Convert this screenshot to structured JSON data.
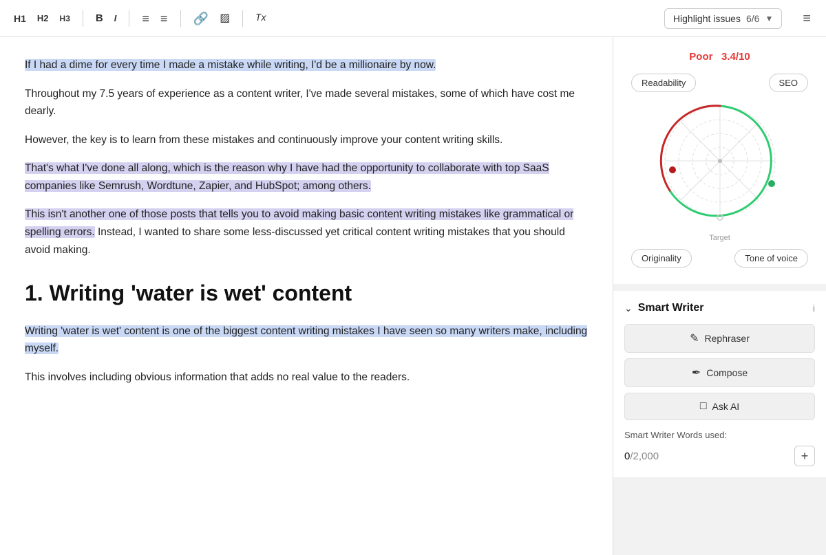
{
  "toolbar": {
    "h1_label": "H1",
    "h2_label": "H2",
    "h3_label": "H3",
    "bold_label": "B",
    "italic_label": "I",
    "ol_icon": "≡",
    "ul_icon": "≡",
    "link_icon": "🔗",
    "image_icon": "▣",
    "eraser_label": "Tx",
    "highlight_label": "Highlight issues",
    "highlight_count": "6/6",
    "hamburger": "≡"
  },
  "score": {
    "prefix": "Poor",
    "value": "3.4",
    "suffix": "/10"
  },
  "radar_labels": {
    "readability": "Readability",
    "seo": "SEO",
    "originality": "Originality",
    "tone_of_voice": "Tone of voice",
    "target": "Target"
  },
  "smart_writer": {
    "title": "Smart Writer",
    "rephraser": "Rephraser",
    "compose": "Compose",
    "ask_ai": "Ask AI",
    "words_used_label": "Smart Writer Words used:",
    "words_used": "0",
    "words_total": "/2,000"
  },
  "editor": {
    "para1_part1": "If I had a dime for every time I made a mistake while writing, I'd be a millionaire by now.",
    "para2": "Throughout my 7.5 years of experience as a content writer, I've made several mistakes, some of which have cost me dearly.",
    "para3": "However, the key is to learn from these mistakes and continuously improve your content writing skills.",
    "para4": "That's what I've done all along, which is the reason why I have had the opportunity to collaborate with top SaaS companies like Semrush, Wordtune, Zapier, and HubSpot; among others.",
    "para5_part1": "This isn't another one of those posts that tells you to avoid making basic content writing mistakes like grammatical or spelling errors.",
    "para5_part2": " Instead, I wanted to share some less-discussed yet critical content writing mistakes that you should avoid making.",
    "heading": "1. Writing 'water is wet' content",
    "para6_part1": "Writing 'water is wet' content is one of the biggest content writing mistakes I have seen so many writers make, including myself.",
    "para7": "This involves including obvious information that adds no real value to the readers."
  }
}
